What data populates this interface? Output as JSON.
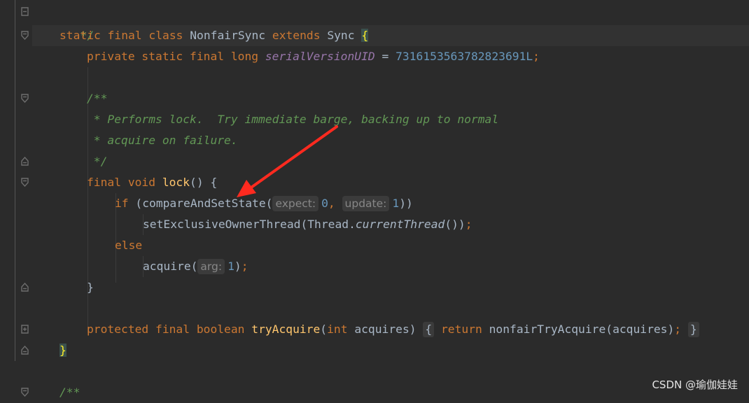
{
  "editor": {
    "lines": {
      "l1": {
        "text": "*/"
      },
      "l2": {
        "kw1": "static final class ",
        "name": "NonfairSync ",
        "kw2": "extends ",
        "parent": "Sync ",
        "brace": "{"
      },
      "l3": {
        "kw": "private static final long ",
        "field": "serialVersionUID",
        "eq": " = ",
        "num": "7316153563782823691L",
        "semi": ";"
      },
      "l5": {
        "doc": "/**"
      },
      "l6": {
        "doc": " * Performs lock.  Try immediate barge, backing up to normal"
      },
      "l7": {
        "doc": " * acquire on failure."
      },
      "l8": {
        "doc": " */"
      },
      "l9": {
        "kw": "final void ",
        "fn": "lock",
        "rest": "() {"
      },
      "l10": {
        "kw": "if ",
        "call": "(compareAndSetState(",
        "hint1": "expect:",
        "num1": "0",
        "comma": ", ",
        "hint2": "update:",
        "num2": "1",
        "close": "))"
      },
      "l11": {
        "call": "setExclusiveOwnerThread(Thread.",
        "method": "currentThread",
        "close": "())",
        "semi": ";"
      },
      "l12": {
        "kw": "else"
      },
      "l13": {
        "call": "acquire(",
        "hint": "arg:",
        "num": "1",
        "close": ")",
        "semi": ";"
      },
      "l14": {
        "text": "}"
      },
      "l16": {
        "kw1": "protected final boolean ",
        "fn": "tryAcquire",
        "params_open": "(",
        "kw2": "int ",
        "param": "acquires)",
        "ob": "{",
        "kw3": "return ",
        "call": "nonfairTryAcquire(acquires)",
        "semi": ";",
        "cb": "}"
      },
      "l17": {
        "brace": "}"
      },
      "l19": {
        "doc": "/**"
      }
    }
  },
  "watermark": "CSDN @瑜伽娃娃",
  "colors": {
    "background": "#2b2b2b",
    "keyword": "#cc7832",
    "function": "#ffc66d",
    "number": "#6897bb",
    "doc_comment": "#629755",
    "arrow": "#ff2a1f"
  }
}
